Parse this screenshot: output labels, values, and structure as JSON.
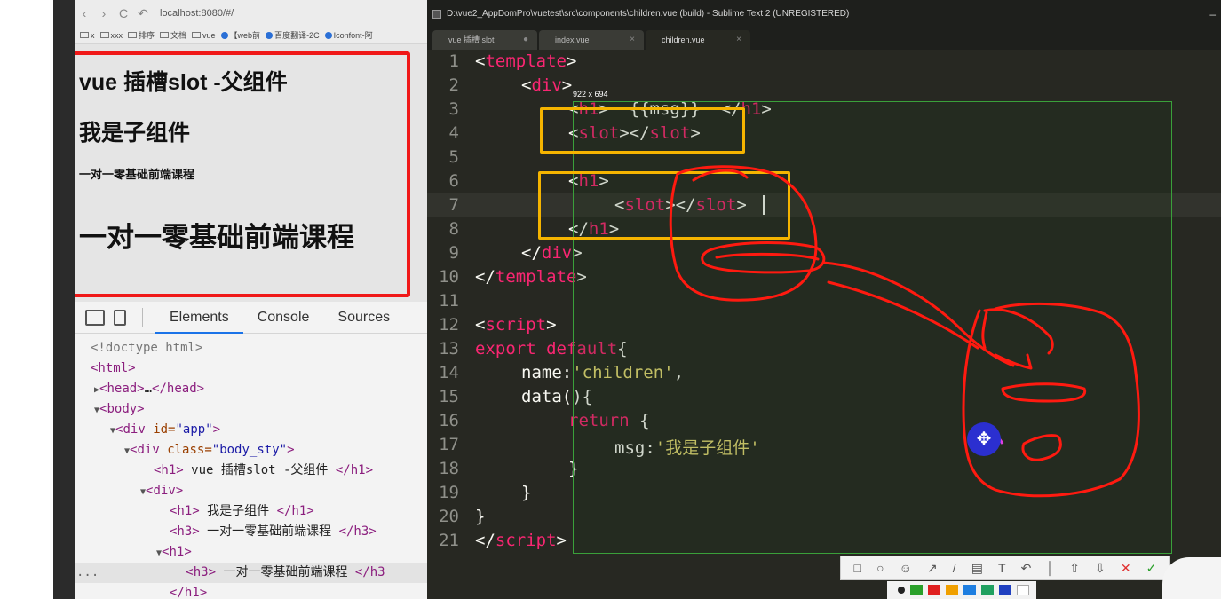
{
  "browser": {
    "nav": {
      "back": "‹",
      "forward": "›",
      "reload": "C",
      "undo": "↶"
    },
    "url": "localhost:8080/#/",
    "bookmarks": [
      "x",
      "xxx",
      "排序",
      "文档",
      "vue",
      "【web前",
      "百度翻译-2C",
      "Iconfont-阿"
    ],
    "page": {
      "h1_parent": "vue 插槽slot -父组件",
      "h1_child": "我是子组件",
      "h3_course": "一对一零基础前端课程",
      "h1_course": "一对一零基础前端课程"
    },
    "devtools": {
      "tabs": [
        "Elements",
        "Console",
        "Sources"
      ],
      "dom": {
        "l1": "<!doctype html>",
        "l2_tag": "<html>",
        "l3_open": "<head>",
        "l3_dots": "…",
        "l3_close": "</head>",
        "l4": "<body>",
        "l5_tag": "<div ",
        "l5_attr": "id=",
        "l5_val": "\"app\"",
        "l5_end": ">",
        "l6_tag": "<div ",
        "l6_attr": "class=",
        "l6_val": "\"body_sty\"",
        "l6_end": ">",
        "l7_open": "<h1>",
        "l7_text": " vue 插槽slot -父组件 ",
        "l7_close": "</h1>",
        "l8": "<div>",
        "l9_open": "<h1>",
        "l9_text": " 我是子组件 ",
        "l9_close": "</h1>",
        "l10_open": "<h3>",
        "l10_text": " 一对一零基础前端课程 ",
        "l10_close": "</h3>",
        "l11": "<h1>",
        "l12_open": "<h3>",
        "l12_text": " 一对一零基础前端课程 ",
        "l12_close": "</h3",
        "l13": "</h1>",
        "ellipsis": "..."
      }
    }
  },
  "sublime": {
    "title": "D:\\vue2_AppDomPro\\vuetest\\src\\components\\children.vue (build) - Sublime Text 2 (UNREGISTERED)",
    "minimize": "–",
    "tabs": [
      {
        "label": "vue 插槽 slot",
        "close": "●"
      },
      {
        "label": "index.vue",
        "close": "×"
      },
      {
        "label": "children.vue",
        "close": "×"
      }
    ],
    "line_numbers": [
      "1",
      "2",
      "3",
      "4",
      "5",
      "6",
      "7",
      "8",
      "9",
      "10",
      "11",
      "12",
      "13",
      "14",
      "15",
      "16",
      "17",
      "18",
      "19",
      "20",
      "21"
    ],
    "code": {
      "l1": [
        "<",
        "template",
        ">"
      ],
      "l2": [
        "<",
        "div",
        ">"
      ],
      "l3": [
        "<",
        "h1",
        ">  {{msg}}  </",
        "h1",
        ">"
      ],
      "l4": [
        "<",
        "slot",
        "></",
        "slot",
        ">"
      ],
      "l6": [
        "<",
        "h1",
        ">"
      ],
      "l7": [
        "<",
        "slot",
        "></",
        "slot",
        ">"
      ],
      "l8": [
        "</",
        "h1",
        ">"
      ],
      "l9": [
        "</",
        "div",
        ">"
      ],
      "l10": [
        "</",
        "template",
        ">"
      ],
      "l12": [
        "<",
        "script",
        ">"
      ],
      "l13": [
        "export default",
        "{"
      ],
      "l14": [
        "name:",
        "'children'",
        ","
      ],
      "l15": [
        "data(){"
      ],
      "l16": [
        "return",
        " {"
      ],
      "l17": [
        "msg:",
        "'我是子组件'"
      ],
      "l18": [
        "}"
      ],
      "l19": [
        "}"
      ],
      "l20": [
        "}"
      ],
      "l21": [
        "</",
        "script",
        ">"
      ]
    },
    "selection_size": "922 x 694",
    "toolbar_icons": [
      "□",
      "○",
      "☺",
      "↗",
      "/",
      "▤",
      "T",
      "↶",
      "│",
      "⇧",
      "⇩",
      "✕",
      "✓"
    ]
  },
  "colors": {
    "red_box": "#f01818",
    "yellow_highlight": "#f5b400",
    "pen_blue": "#2b2fd0",
    "annotation_red": "#ff1a10",
    "tag_pink": "#f92672",
    "string_yellow": "#e6db74"
  },
  "palette": [
    "#222222",
    "#2aa02a",
    "#e02020",
    "#f0a000",
    "#1e7ee0",
    "#20a060",
    "#2040c0",
    "#ffffff"
  ]
}
